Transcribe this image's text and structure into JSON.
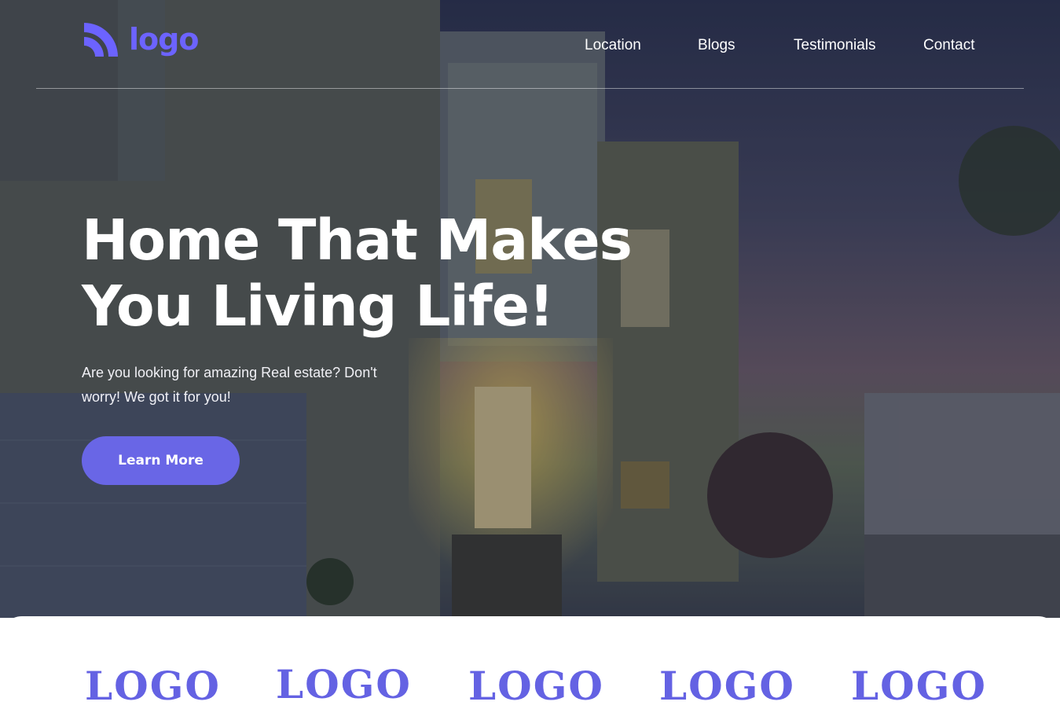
{
  "header": {
    "logo_text": "logo",
    "logo_icon": "signal-arcs-icon",
    "nav": [
      "Location",
      "Blogs",
      "Testimonials",
      "Contact"
    ]
  },
  "hero": {
    "headline_line1": "Home That Makes",
    "headline_line2": "You Living Life!",
    "subtext": "Are you looking for amazing Real estate? Don't worry! We got it for you!",
    "cta_label": "Learn More"
  },
  "partners": {
    "logos": [
      "LOGO",
      "LOGO",
      "LOGO",
      "LOGO",
      "LOGO"
    ]
  },
  "colors": {
    "accent": "#6966e6",
    "text_on_dark": "#ffffff",
    "background": "#ffffff"
  }
}
